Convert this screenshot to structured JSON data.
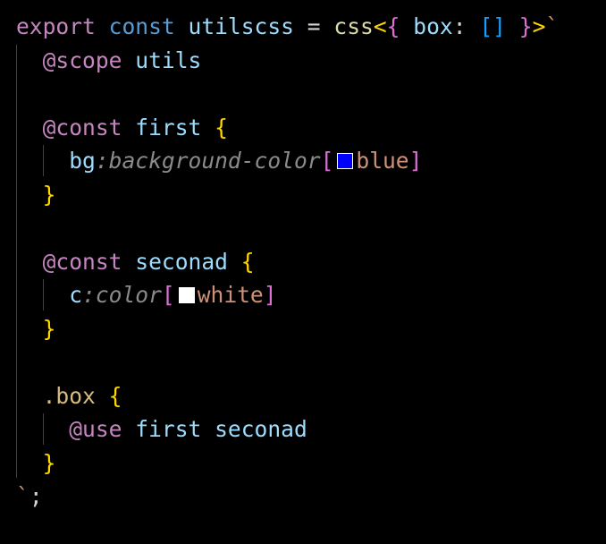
{
  "code": {
    "line1": {
      "export_kw": "export",
      "const_kw": "const",
      "var_name": "utilscss",
      "equals": "=",
      "fn_name": "css",
      "lt": "<",
      "open_brace": "{",
      "key": "box",
      "colon": ":",
      "array": "[]",
      "close_brace": "}",
      "gt": ">",
      "backtick": "`"
    },
    "line2": {
      "at_rule": "@scope",
      "name": "utils"
    },
    "line4": {
      "at_rule": "@const",
      "name": "first",
      "brace": "{"
    },
    "line5": {
      "prop": "bg",
      "hint": ":background-color",
      "open": "[",
      "value": "blue",
      "close": "]",
      "swatch_color": "#0000ff"
    },
    "line6": {
      "brace": "}"
    },
    "line8": {
      "at_rule": "@const",
      "name": "seconad",
      "brace": "{"
    },
    "line9": {
      "prop": "c",
      "hint": ":color",
      "open": "[",
      "value": "white",
      "close": "]",
      "swatch_color": "#ffffff"
    },
    "line10": {
      "brace": "}"
    },
    "line12": {
      "selector": ".box",
      "brace": "{"
    },
    "line13": {
      "at_rule": "@use",
      "args": "first seconad"
    },
    "line14": {
      "brace": "}"
    },
    "line15": {
      "backtick": "`",
      "semicolon": ";"
    }
  }
}
